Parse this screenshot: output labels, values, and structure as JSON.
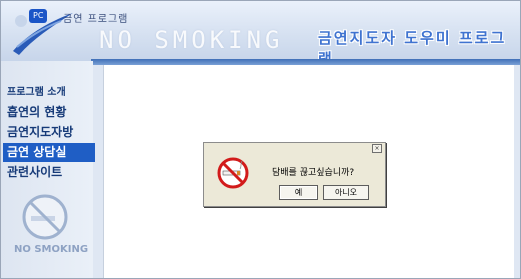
{
  "header": {
    "brand_badge": "PC",
    "brand_name": "금연 프로그램",
    "background_text": "NO SMOKING",
    "title": "금연지도자 도우미 프로그램"
  },
  "sidebar": {
    "items": [
      {
        "label": "프로그램 소개",
        "active": false
      },
      {
        "label": "흡연의 현황",
        "active": false
      },
      {
        "label": "금연지도자방",
        "active": false
      },
      {
        "label": "금연 상담실",
        "active": true
      },
      {
        "label": "관련사이트",
        "active": false
      }
    ],
    "nosmoke_text": "NO SMOKING"
  },
  "dialog": {
    "close_glyph": "×",
    "message": "담배를 끊고싶습니까?",
    "yes_label": "예",
    "no_label": "아니오"
  },
  "colors": {
    "accent": "#1f5ec5",
    "menu_text": "#163a78",
    "title": "#3f73d0"
  }
}
